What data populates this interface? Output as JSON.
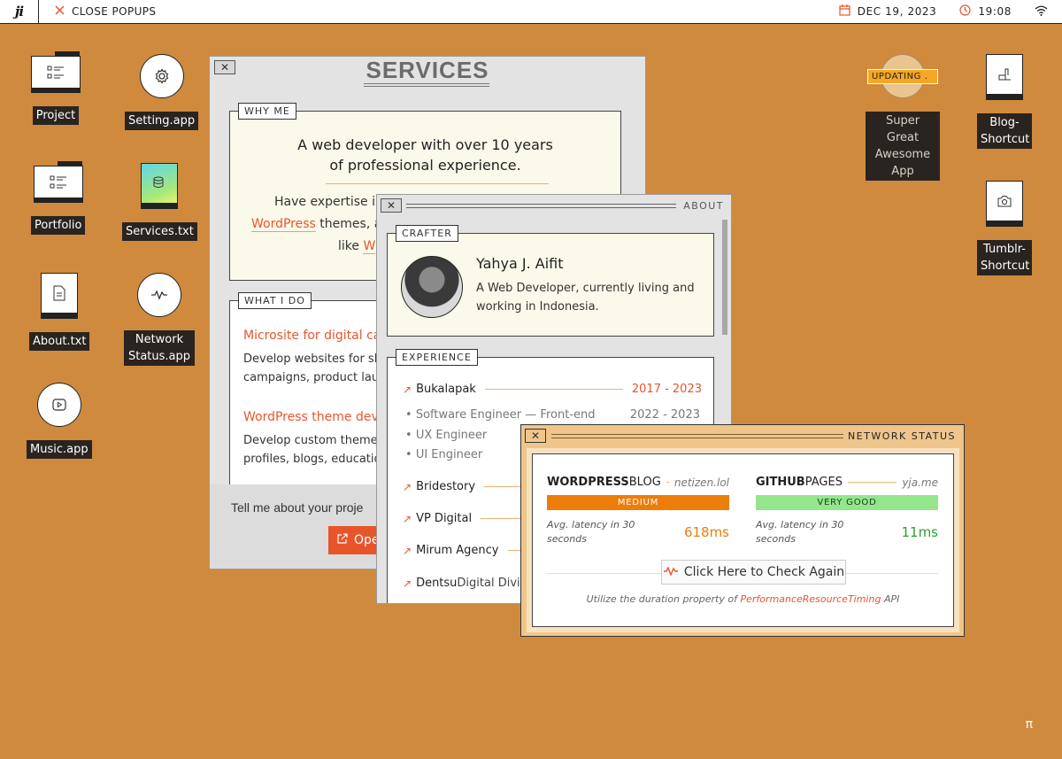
{
  "topbar": {
    "logo_text": "ji",
    "close_popups": "CLOSE POPUPS",
    "date": "DEC 19, 2023",
    "time": "19:08"
  },
  "desktop_icons": {
    "project": "Project",
    "setting": "Setting.app",
    "portfolio": "Portfolio",
    "services": "Services.txt",
    "about": "About.txt",
    "network": "Network Status.app",
    "music": "Music.app",
    "super_app": "Super Great Awesome App",
    "super_app_badge": "UPDATING .",
    "blog": "Blog-Shortcut",
    "tumblr": "Tumblr-Shortcut"
  },
  "services": {
    "title": "SERVICES",
    "why_me_tag": "WHY ME",
    "headline_1": "A web developer with over 10 years",
    "headline_2": "of professional experience.",
    "body_1": "Have expertise in",
    "body_2_link": "WordPress",
    "body_2_rest": " themes, a",
    "body_3": "like ",
    "body_3_link": "W",
    "what_i_do_tag": "WHAT I DO",
    "item1_title": "Microsite for digital ca",
    "item1_desc_1": "Develop websites for sh",
    "item1_desc_2": "campaigns, product lau",
    "item2_title": "WordPress theme deve",
    "item2_desc_1": "Develop custom themes",
    "item2_desc_2": "profiles, blogs, educatio",
    "footer_text": "Tell me about your proje",
    "footer_button": "Ope"
  },
  "about": {
    "title": "ABOUT",
    "crafter_tag": "CRAFTER",
    "name": "Yahya J. Aifit",
    "bio_1": "A Web Developer, currently living and",
    "bio_2": "working in Indonesia.",
    "experience_tag": "EXPERIENCE",
    "jobs": [
      {
        "company": "Bukalapak",
        "years": "2017 - 2023"
      },
      {
        "company": "Bridestory"
      },
      {
        "company": "VP Digital"
      },
      {
        "company": "Mirum Agency"
      },
      {
        "company": "Dentsu",
        "suffix": " Digital Divi"
      }
    ],
    "roles": [
      {
        "title": "Software Engineer — Front-end",
        "years": "2022 - 2023"
      },
      {
        "title": "UX Engineer"
      },
      {
        "title": "UI Engineer"
      }
    ]
  },
  "network": {
    "title": "NETWORK STATUS",
    "wp_name_bold": "WORDPRESS",
    "wp_name_rest": " BLOG",
    "wp_host": "netizen.lol",
    "wp_status": "MEDIUM",
    "wp_latency_label": "Avg. latency in 30 seconds",
    "wp_latency": "618ms",
    "gh_name_bold": "GITHUB",
    "gh_name_rest": " PAGES",
    "gh_host": "yja.me",
    "gh_status": "VERY GOOD",
    "gh_latency_label": "Avg. latency in 30 seconds",
    "gh_latency": "11ms",
    "check_button": "Click Here to Check Again",
    "footnote_pre": "Utilize the duration property of ",
    "footnote_link": "PerformanceResourceTiming",
    "footnote_post": " API"
  },
  "corner_symbol": "π",
  "colors": {
    "desktop": "#cf8a3e",
    "accent": "#e8552b",
    "status_medium": "#ec7d0b",
    "status_good": "#93e68c"
  }
}
